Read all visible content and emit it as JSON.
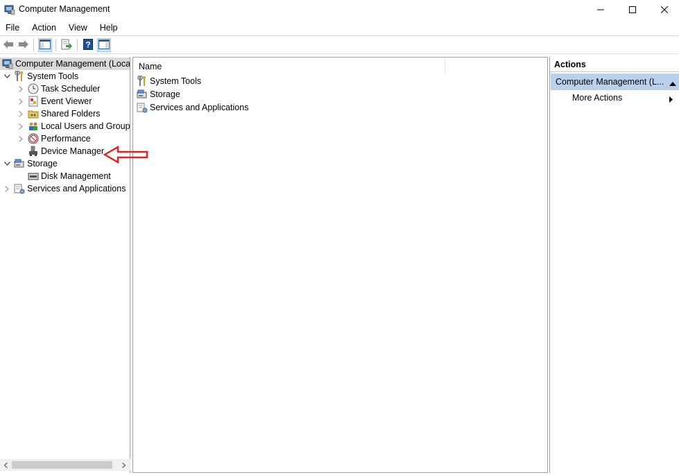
{
  "window": {
    "title": "Computer Management",
    "min_glyph": "—",
    "max_glyph": "☐",
    "close_glyph": "✕"
  },
  "menu": [
    "File",
    "Action",
    "View",
    "Help"
  ],
  "tree": {
    "root": "Computer Management (Local",
    "system_tools": "System Tools",
    "task_scheduler": "Task Scheduler",
    "event_viewer": "Event Viewer",
    "shared_folders": "Shared Folders",
    "local_users": "Local Users and Groups",
    "performance": "Performance",
    "device_manager": "Device Manager",
    "storage": "Storage",
    "disk_management": "Disk Management",
    "services": "Services and Applications"
  },
  "center": {
    "column_name": "Name",
    "items": [
      "System Tools",
      "Storage",
      "Services and Applications"
    ]
  },
  "actions": {
    "header": "Actions",
    "group": "Computer Management (L...",
    "more": "More Actions"
  },
  "colors": {
    "selection": "#d9d9d9",
    "actions_group": "#b9d1ea",
    "annotation": "#e02020"
  },
  "icons": {
    "back": "back-arrow-icon",
    "forward": "forward-arrow-icon",
    "show_hide_tree": "show-hide-tree-icon",
    "export": "export-list-icon",
    "help": "help-icon",
    "action_pane": "show-action-pane-icon"
  }
}
